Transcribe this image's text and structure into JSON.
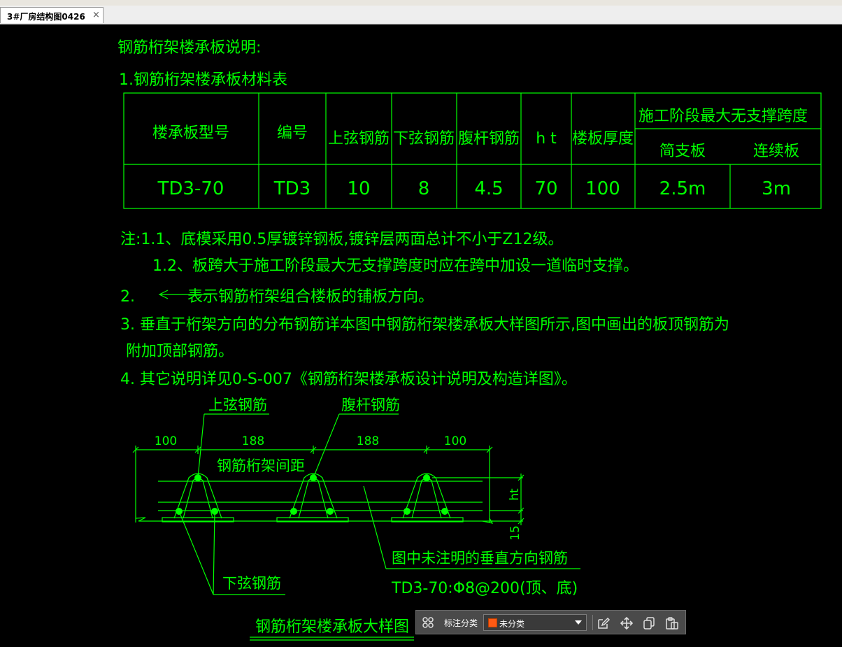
{
  "tab": {
    "title": "3#厂房结构图0426",
    "close": "×"
  },
  "drawing": {
    "heading": "钢筋桁架楼承板说明:",
    "section1": "1.钢筋桁架楼承板材料表",
    "table": {
      "headers": [
        "楼承板型号",
        "编号",
        "上弦钢筋",
        "下弦钢筋",
        "腹杆钢筋",
        "h t",
        "楼板厚度"
      ],
      "group_header": "施工阶段最大无支撑跨度",
      "sub_headers": [
        "简支板",
        "连续板"
      ],
      "row": [
        "TD3-70",
        "TD3",
        "10",
        "8",
        "4.5",
        "70",
        "100",
        "2.5m",
        "3m"
      ]
    },
    "notes": [
      "注:1.1、底模采用0.5厚镀锌钢板,镀锌层两面总计不小于Z12级。",
      "1.2、板跨大于施工阶段最大无支撑跨度时应在跨中加设一道临时支撑。",
      "2.",
      "表示钢筋桁架组合楼板的铺板方向。",
      "3. 垂直于桁架方向的分布钢筋详本图中钢筋桁架楼承板大样图所示,图中画出的板顶钢筋为",
      "附加顶部钢筋。",
      "4. 其它说明详见0-S-007《钢筋桁架楼承板设计说明及构造详图》。"
    ],
    "detail": {
      "top_chord": "上弦钢筋",
      "web": "腹杆钢筋",
      "dims": [
        "100",
        "188",
        "188",
        "100"
      ],
      "spacing": "钢筋桁架间距",
      "ht": "ht",
      "fifteen": "15",
      "perp_note": "图中未注明的垂直方向钢筋",
      "perp_spec": "TD3-70:Φ8@200(顶、底)",
      "bottom_chord": "下弦钢筋",
      "title": "钢筋桁架楼承板大样图"
    }
  },
  "toolbar": {
    "label": "标注分类",
    "category": "未分类",
    "swatch_color": "#ff5a14",
    "icons": [
      "grid-icon",
      "edit-icon",
      "move-icon",
      "copy-icon",
      "paste-icon"
    ]
  },
  "colors": {
    "cad_line": "#00ff00",
    "background": "#000000"
  }
}
